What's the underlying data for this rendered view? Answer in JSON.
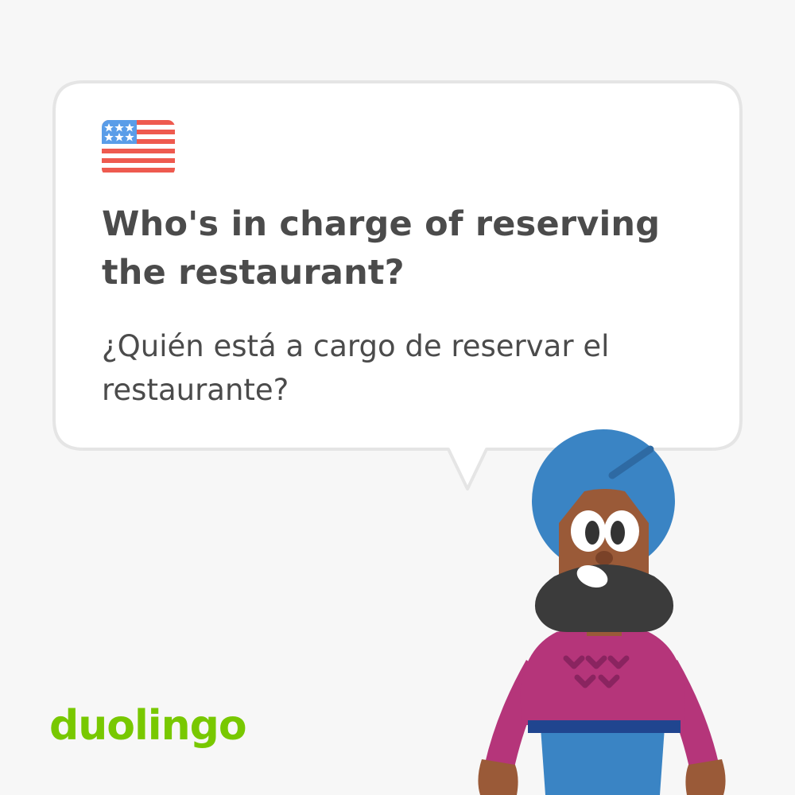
{
  "card": {
    "language_flag_icon": "us-flag-icon",
    "phrase": "Who's in charge of reserving the restaurant?",
    "translation": "¿Quién está a cargo de reservar el restaurante?"
  },
  "brand": {
    "logo_text": "duolingo",
    "logo_color": "#78c800"
  },
  "character": {
    "icon": "duolingo-character-with-turban",
    "turban_color": "#3a84c4",
    "sweater_color": "#b5357a"
  }
}
